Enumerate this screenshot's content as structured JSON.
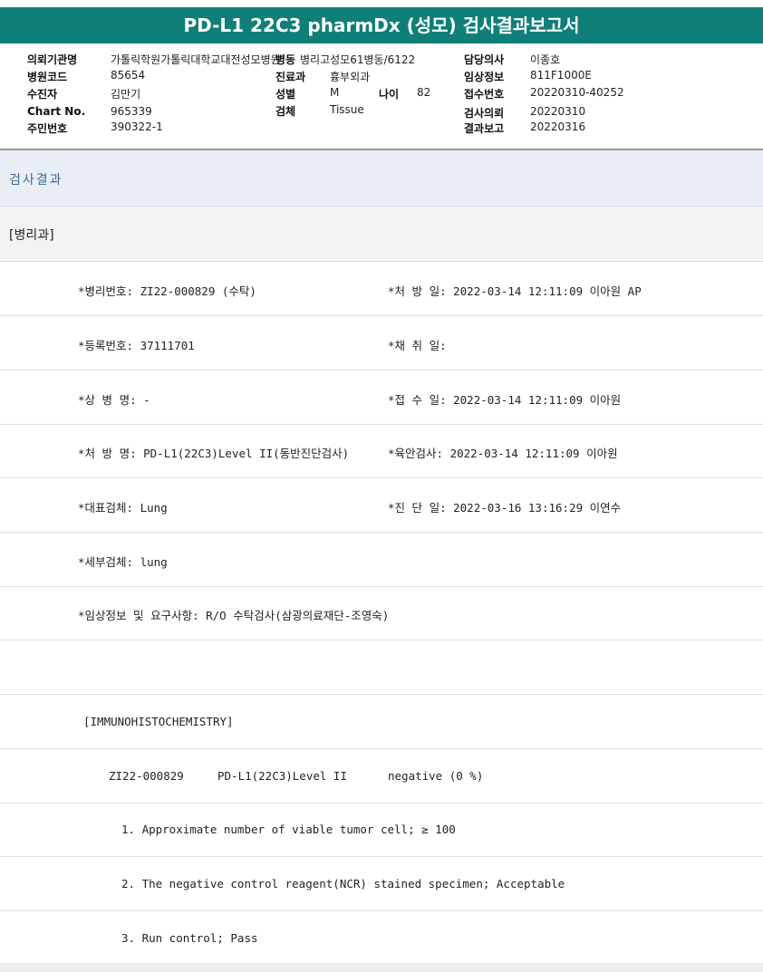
{
  "title": "PD-L1 22C3 pharmDx (성모) 검사결과보고서",
  "patient_info": {
    "institution_label": "의뢰기관명",
    "institution_value": "가톨릭학원가톨릭대학교대전성모병원",
    "ward_label": "병동",
    "ward_value": "병리고성모61병동/6122",
    "doctor_label": "담당의사",
    "doctor_value": "이종호",
    "hospital_code_label": "병원코드",
    "hospital_code_value": "85654",
    "department_label": "진료과",
    "department_value": "흉부외과",
    "clinical_info_label": "임상정보",
    "clinical_info_value": "811F1000E",
    "recipient_label": "수진자",
    "recipient_value": "김만기",
    "sex_label": "성별",
    "sex_value": "M",
    "age_label": "나이",
    "age_value": "82",
    "receipt_no_label": "접수번호",
    "receipt_no_value": "20220310-40252",
    "chart_no_label": "Chart No.",
    "chart_no_value": "965339",
    "specimen_label": "검체",
    "specimen_value": "Tissue",
    "request_label": "검사의뢰",
    "request_value": "20220310",
    "resident_no_label": "주민번호",
    "resident_no_value": "390322-1",
    "report_label": "결과보고",
    "report_value": "20220316"
  },
  "section_title": "검사결과",
  "department_tag": "[병리과]",
  "rows": [
    {
      "left": "*병리번호: ZI22-000829 (수탁)",
      "right": "*처 방 일: 2022-03-14 12:11:09  이아원 AP"
    },
    {
      "left": "*등록번호: 37111701",
      "right": "*채 취 일:"
    },
    {
      "left": "*상 병 명: -",
      "right": "*접 수 일: 2022-03-14 12:11:09  이아원"
    },
    {
      "left": "*처 방 명: PD-L1(22C3)Level II(동반진단검사)",
      "right": "*육안검사: 2022-03-14 12:11:09  이아원"
    },
    {
      "left": "*대표검체: Lung",
      "right": "*진 단 일: 2022-03-16 13:16:29  이연수"
    },
    {
      "left": "*세부검체: lung",
      "right": ""
    },
    {
      "left": "*임상정보 및 요구사항: R/O 수탁검사(삼광의료재단-조영숙)",
      "right": ""
    }
  ],
  "ihc": {
    "header": "[IMMUNOHISTOCHEMISTRY]",
    "specimen_id": "ZI22-000829",
    "test_name": "PD-L1(22C3)Level II",
    "result": "negative (0 %)",
    "item1": "1. Approximate number of viable tumor cell; ≥ 100",
    "item2": "2. The negative control reagent(NCR) stained specimen; Acceptable",
    "item3": "3. Run control; Pass"
  }
}
